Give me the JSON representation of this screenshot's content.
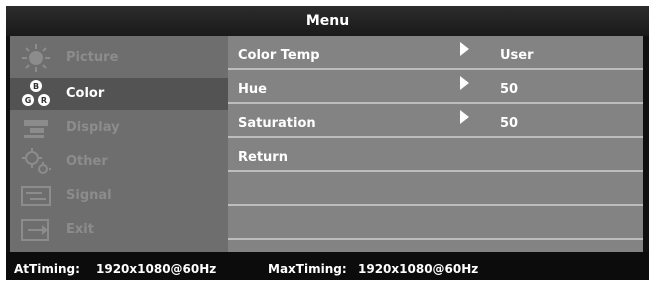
{
  "menu": {
    "title": "Menu"
  },
  "sidebar": {
    "items": [
      {
        "label": "Picture",
        "icon": "sun-icon",
        "active": false
      },
      {
        "label": "Color",
        "icon": "rgb-circles-icon",
        "active": true
      },
      {
        "label": "Display",
        "icon": "display-icon",
        "active": false
      },
      {
        "label": "Other",
        "icon": "gear-icon",
        "active": false
      },
      {
        "label": "Signal",
        "icon": "signal-icon",
        "active": false
      },
      {
        "label": "Exit",
        "icon": "exit-icon",
        "active": false
      }
    ],
    "color_icon_letters": {
      "top": "B",
      "left": "G",
      "right": "R"
    }
  },
  "main": {
    "rows": [
      {
        "label": "Color Temp",
        "value": "User",
        "has_arrow": true
      },
      {
        "label": "Hue",
        "value": "50",
        "has_arrow": true
      },
      {
        "label": "Saturation",
        "value": "50",
        "has_arrow": true
      },
      {
        "label": "Return",
        "value": "",
        "has_arrow": false
      },
      {
        "label": "",
        "value": "",
        "has_arrow": false
      },
      {
        "label": "",
        "value": "",
        "has_arrow": false
      }
    ]
  },
  "status": {
    "at_timing_label": "AtTiming:",
    "at_timing_value": "1920x1080@60Hz",
    "max_timing_label": "MaxTiming:",
    "max_timing_value": "1920x1080@60Hz"
  },
  "colors": {
    "frame": "#101010",
    "sidebar_bg": "#6e6e6e",
    "sidebar_active_bg": "#535353",
    "main_bg": "#838383",
    "divider": "#bdbdbd",
    "text": "#ffffff",
    "text_dim": "#8c8c8c"
  }
}
